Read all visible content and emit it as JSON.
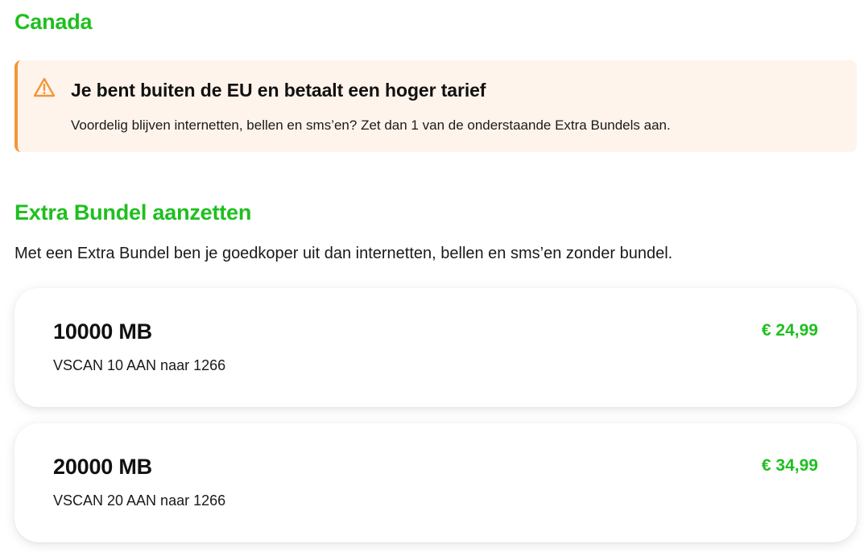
{
  "page": {
    "country_title": "Canada"
  },
  "notice": {
    "icon": "warning-triangle-icon",
    "title": "Je bent buiten de EU en betaalt een hoger tarief",
    "text": "Voordelig blijven internetten, bellen en sms’en? Zet dan 1 van de onderstaande Extra Bundels aan.",
    "accent_color": "#f0973a",
    "background_color": "#fff4ec"
  },
  "section": {
    "title": "Extra Bundel aanzetten",
    "description": "Met een Extra Bundel ben je goedkoper uit dan internetten, bellen en sms’en zonder bundel."
  },
  "bundles": [
    {
      "size": "10000 MB",
      "code": "VSCAN 10 AAN naar 1266",
      "price": "€ 24,99"
    },
    {
      "size": "20000 MB",
      "code": "VSCAN 20 AAN naar 1266",
      "price": "€ 34,99"
    }
  ],
  "colors": {
    "brand_green": "#1fbf1f",
    "text": "#1a1a1a"
  }
}
